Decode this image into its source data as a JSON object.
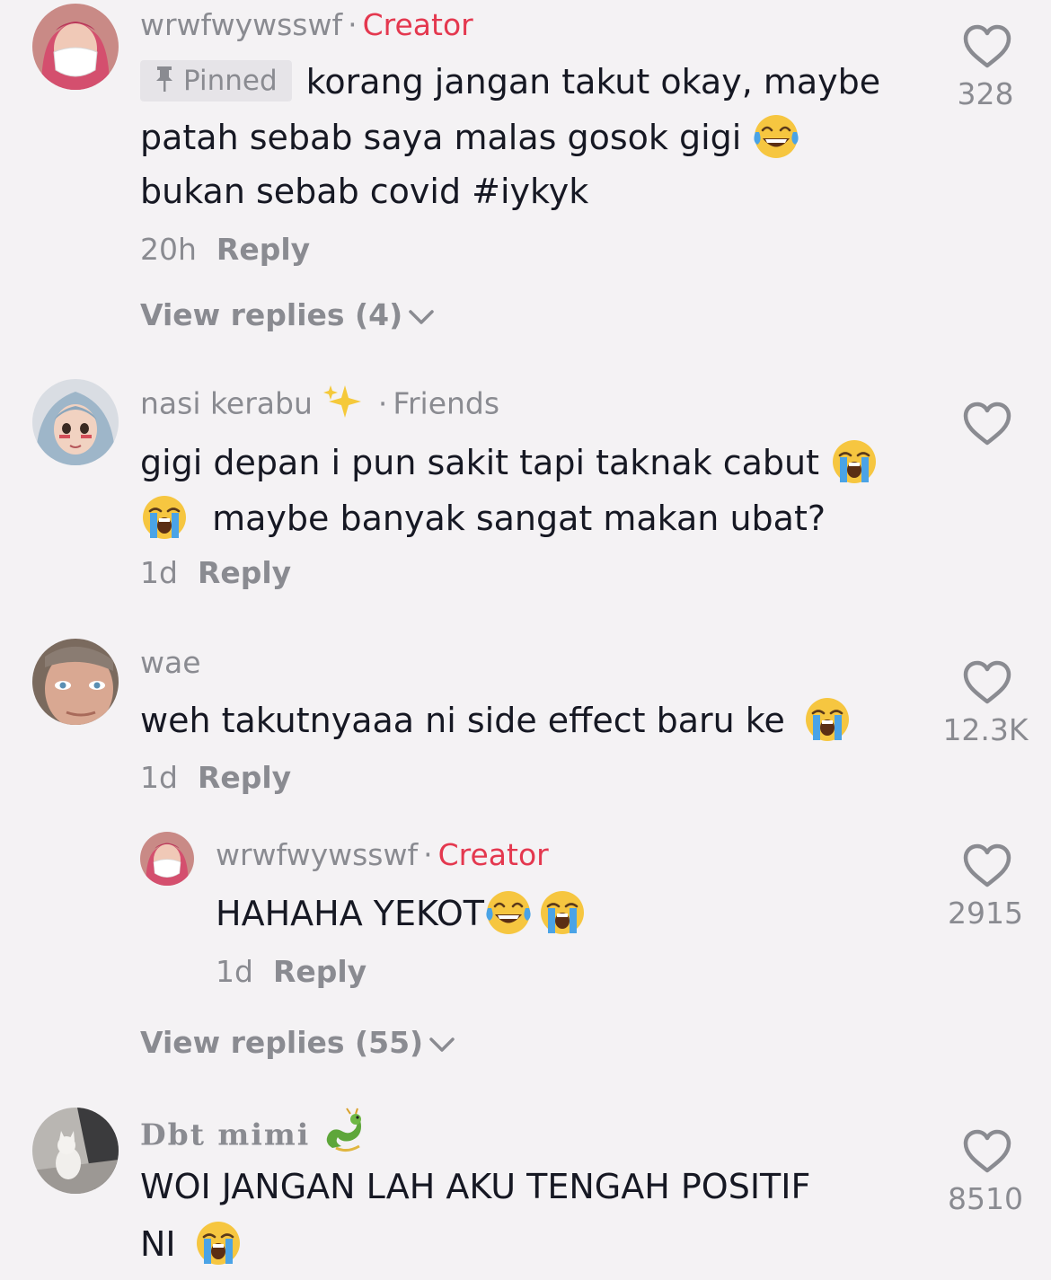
{
  "comments": [
    {
      "username": "wrwfwywsswf",
      "role": "Creator",
      "pinned_label": "Pinned",
      "lines": [
        "korang jangan takut okay, maybe",
        "patah sebab saya malas gosok gigi",
        "bukan sebab covid #iykyk"
      ],
      "time": "20h",
      "reply_label": "Reply",
      "likes": "328",
      "view_replies": "View replies (4)"
    },
    {
      "username": "nasi kerabu",
      "role": "Friends",
      "lines": [
        "gigi depan i pun sakit tapi taknak cabut",
        "maybe banyak sangat makan ubat?"
      ],
      "time": "1d",
      "reply_label": "Reply",
      "likes": ""
    },
    {
      "username": "wae",
      "lines": [
        "weh takutnyaaa ni side effect baru ke"
      ],
      "time": "1d",
      "reply_label": "Reply",
      "likes": "12.3K",
      "reply": {
        "username": "wrwfwywsswf",
        "role": "Creator",
        "lines": [
          "HAHAHA YEKOT"
        ],
        "time": "1d",
        "reply_label": "Reply",
        "likes": "2915"
      },
      "view_replies": "View replies (55)"
    },
    {
      "username": "Dbt mimi",
      "lines": [
        "WOI JANGAN LAH AKU TENGAH POSITIF",
        "NI"
      ],
      "likes": "8510"
    }
  ],
  "icons": {
    "like": "heart-outline-icon",
    "expand": "chevron-down-icon",
    "pin": "pin-icon",
    "emoji_laugh": "face-with-tears-of-joy",
    "emoji_cry": "loudly-crying-face",
    "sparkles": "sparkles-icon",
    "dragon": "dragon-icon"
  },
  "colors": {
    "background": "#f4f2f4",
    "creator": "#e4384f",
    "muted": "#8a8b91",
    "text": "#161823"
  }
}
